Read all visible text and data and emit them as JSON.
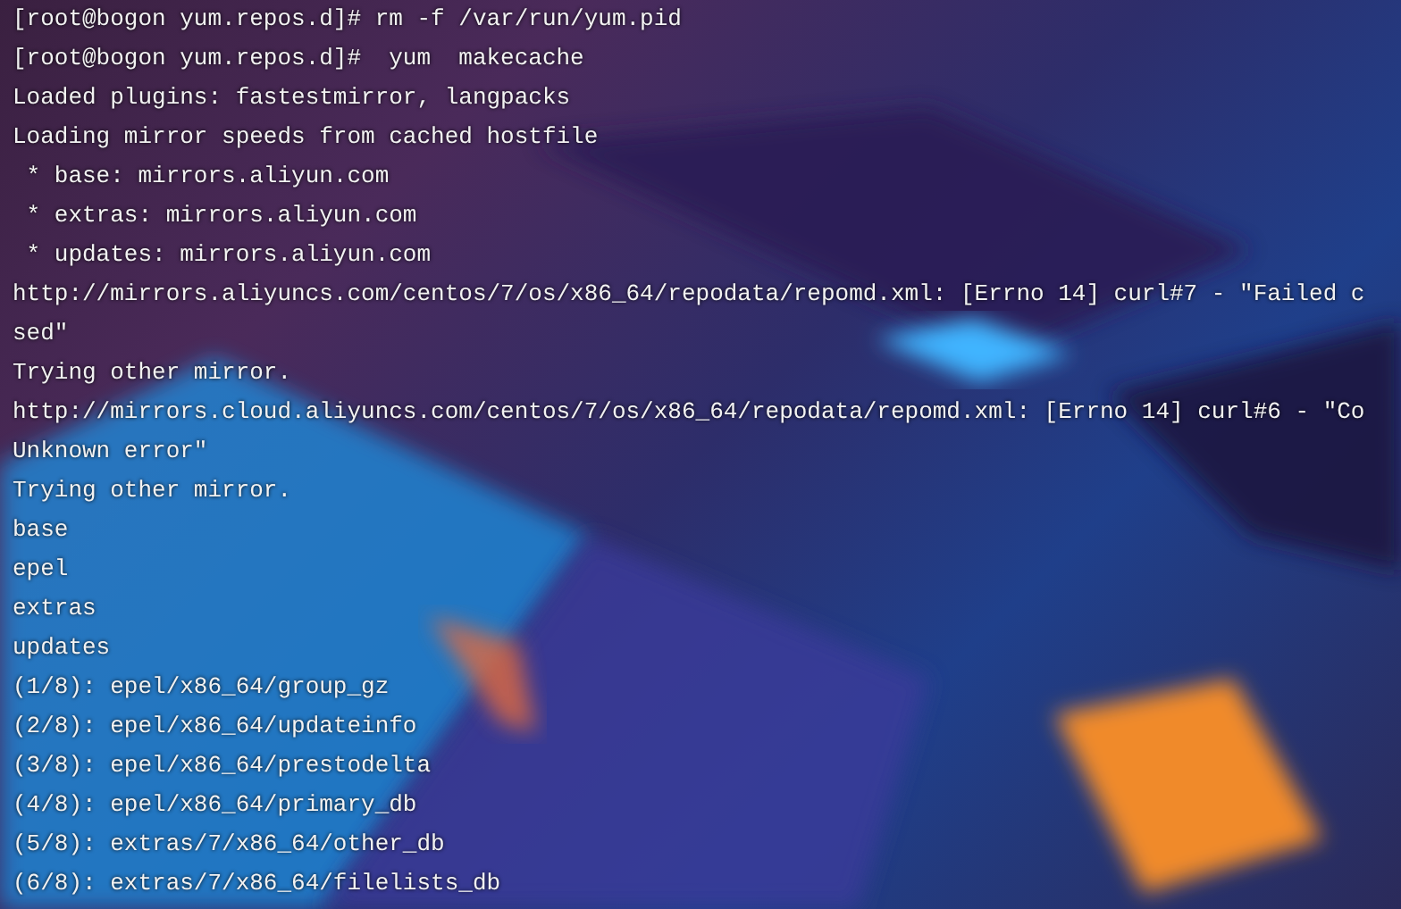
{
  "terminal": {
    "lines": [
      "[root@bogon yum.repos.d]# rm -f /var/run/yum.pid",
      "[root@bogon yum.repos.d]#  yum  makecache",
      "Loaded plugins: fastestmirror, langpacks",
      "Loading mirror speeds from cached hostfile",
      " * base: mirrors.aliyun.com",
      " * extras: mirrors.aliyun.com",
      " * updates: mirrors.aliyun.com",
      "http://mirrors.aliyuncs.com/centos/7/os/x86_64/repodata/repomd.xml: [Errno 14] curl#7 - \"Failed c",
      "sed\"",
      "Trying other mirror.",
      "http://mirrors.cloud.aliyuncs.com/centos/7/os/x86_64/repodata/repomd.xml: [Errno 14] curl#6 - \"Co",
      "Unknown error\"",
      "Trying other mirror.",
      "base",
      "epel",
      "extras",
      "updates",
      "(1/8): epel/x86_64/group_gz",
      "(2/8): epel/x86_64/updateinfo",
      "(3/8): epel/x86_64/prestodelta",
      "(4/8): epel/x86_64/primary_db",
      "(5/8): extras/7/x86_64/other_db",
      "(6/8): extras/7/x86_64/filelists_db"
    ]
  }
}
